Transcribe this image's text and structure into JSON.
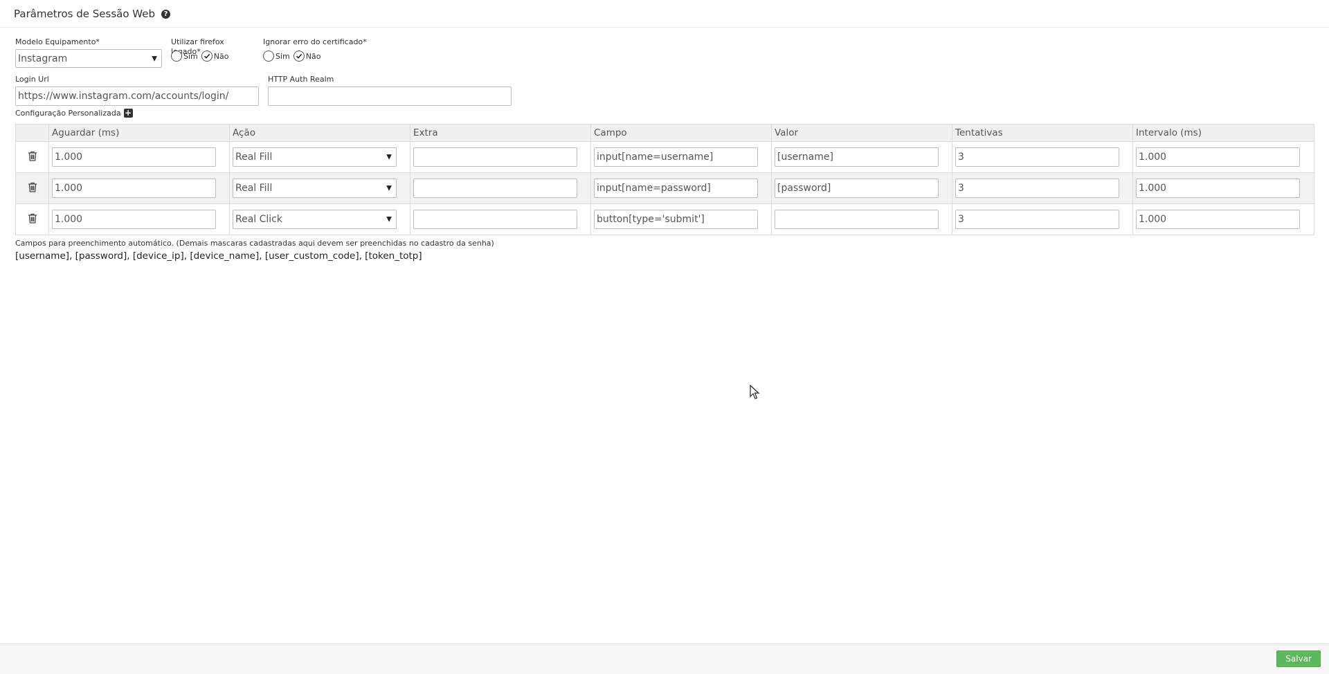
{
  "header": {
    "title": "Parâmetros de Sessão Web",
    "help_icon": "question-circle-icon"
  },
  "form": {
    "modelo": {
      "label": "Modelo Equipamento*",
      "value": "Instagram"
    },
    "firefox": {
      "label": "Utilizar firefox logado*",
      "yes": "Sim",
      "no": "Não",
      "selected": "Não"
    },
    "certificado": {
      "label": "Ignorar erro do certificado*",
      "yes": "Sim",
      "no": "Não",
      "selected": "Não"
    },
    "login_url": {
      "label": "Login Url",
      "value": "https://www.instagram.com/accounts/login/"
    },
    "http_auth": {
      "label": "HTTP Auth Realm",
      "value": ""
    },
    "config_label": "Configuração Personalizada"
  },
  "table": {
    "headers": [
      "Aguardar (ms)",
      "Ação",
      "Extra",
      "Campo",
      "Valor",
      "Tentativas",
      "Intervalo (ms)"
    ],
    "rows": [
      {
        "aguardar": "1.000",
        "acao": "Real Fill",
        "extra": "",
        "campo": "input[name=username]",
        "valor": "[username]",
        "tentativas": "3",
        "intervalo": "1.000"
      },
      {
        "aguardar": "1.000",
        "acao": "Real Fill",
        "extra": "",
        "campo": "input[name=password]",
        "valor": "[password]",
        "tentativas": "3",
        "intervalo": "1.000"
      },
      {
        "aguardar": "1.000",
        "acao": "Real Click",
        "extra": "",
        "campo": "button[type='submit']",
        "valor": "",
        "tentativas": "3",
        "intervalo": "1.000"
      }
    ]
  },
  "hint": "Campos para preenchimento automático. (Demais mascaras cadastradas aqui devem ser preenchidas no cadastro da senha)",
  "variables": "[username], [password], [device_ip], [device_name], [user_custom_code], [token_totp]",
  "footer": {
    "save_label": "Salvar"
  },
  "colors": {
    "save_button": "#5cb85c",
    "header_bg": "#f0f0f0"
  }
}
